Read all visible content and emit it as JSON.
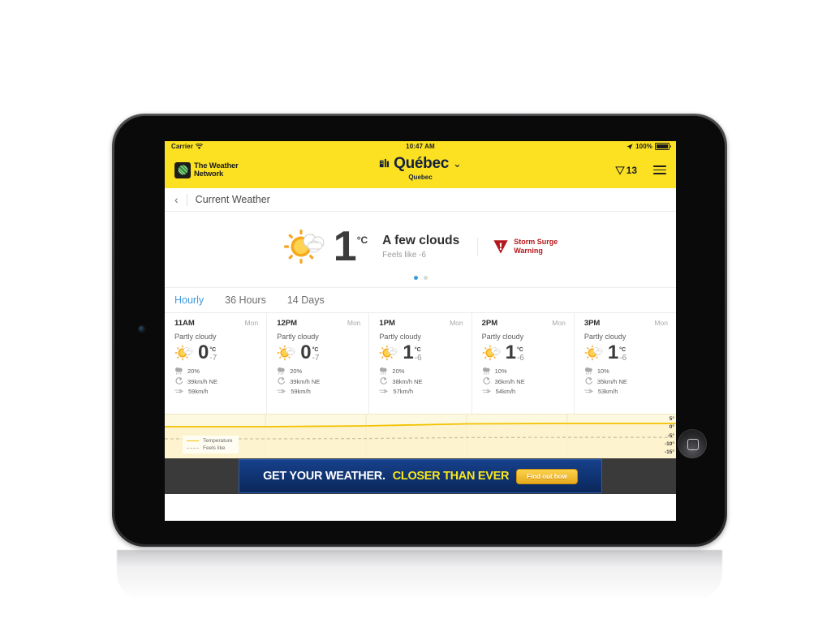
{
  "status_bar": {
    "carrier": "Carrier",
    "wifi_icon": "wifi-icon",
    "time": "10:47 AM",
    "location_icon": "location-arrow-icon",
    "battery_percent": "100%"
  },
  "header": {
    "logo_line1": "The Weather",
    "logo_line2": "Network",
    "logo_icon": "weather-network-globe-icon",
    "city_icon": "city-buildings-icon",
    "city": "Québec",
    "chevron": "⌄",
    "region": "Quebec",
    "alert_icon": "alert-triangle-icon",
    "alert_count": "13",
    "menu_icon": "hamburger-menu-icon"
  },
  "nav": {
    "back_icon": "chevron-left-icon",
    "title": "Current Weather"
  },
  "current": {
    "weather_icon": "sun-behind-cloud-icon",
    "temperature": "1",
    "unit": "°C",
    "condition": "A few clouds",
    "feels_like": "Feels like -6",
    "warning_icon": "storm-warning-triangle-icon",
    "warning_line1": "Storm Surge",
    "warning_line2": "Warning",
    "pagination": {
      "total": 2,
      "active": 0
    }
  },
  "tabs": [
    {
      "label": "Hourly",
      "active": true
    },
    {
      "label": "36 Hours",
      "active": false
    },
    {
      "label": "14 Days",
      "active": false
    }
  ],
  "hourly": [
    {
      "time": "11AM",
      "day": "Mon",
      "condition": "Partly cloudy",
      "icon": "sun-behind-cloud-icon",
      "temp": "0",
      "unit": "°C",
      "feels_like": "-7",
      "precip_icon": "rain-cloud-icon",
      "precip": "20%",
      "wind_icon": "wind-direction-icon",
      "wind": "39km/h NE",
      "gust_icon": "wind-gust-icon",
      "gust": "59km/h"
    },
    {
      "time": "12PM",
      "day": "Mon",
      "condition": "Partly cloudy",
      "icon": "sun-behind-cloud-icon",
      "temp": "0",
      "unit": "°C",
      "feels_like": "-7",
      "precip_icon": "rain-cloud-icon",
      "precip": "20%",
      "wind_icon": "wind-direction-icon",
      "wind": "39km/h NE",
      "gust_icon": "wind-gust-icon",
      "gust": "59km/h"
    },
    {
      "time": "1PM",
      "day": "Mon",
      "condition": "Partly cloudy",
      "icon": "sun-behind-cloud-icon",
      "temp": "1",
      "unit": "°C",
      "feels_like": "-6",
      "precip_icon": "rain-cloud-icon",
      "precip": "20%",
      "wind_icon": "wind-direction-icon",
      "wind": "38km/h NE",
      "gust_icon": "wind-gust-icon",
      "gust": "57km/h"
    },
    {
      "time": "2PM",
      "day": "Mon",
      "condition": "Partly cloudy",
      "icon": "sun-behind-cloud-icon",
      "temp": "1",
      "unit": "°C",
      "feels_like": "-6",
      "precip_icon": "rain-cloud-icon",
      "precip": "10%",
      "wind_icon": "wind-direction-icon",
      "wind": "36km/h NE",
      "gust_icon": "wind-gust-icon",
      "gust": "54km/h"
    },
    {
      "time": "3PM",
      "day": "Mon",
      "condition": "Partly cloudy",
      "icon": "sun-behind-cloud-icon",
      "temp": "1",
      "unit": "°C",
      "feels_like": "-6",
      "precip_icon": "rain-cloud-icon",
      "precip": "10%",
      "wind_icon": "wind-direction-icon",
      "wind": "35km/h NE",
      "gust_icon": "wind-gust-icon",
      "gust": "53km/h"
    }
  ],
  "chart_data": {
    "type": "line",
    "title": "",
    "xlabel": "",
    "ylabel": "",
    "categories": [
      "11AM",
      "12PM",
      "1PM",
      "2PM",
      "3PM"
    ],
    "series": [
      {
        "name": "Temperature",
        "values": [
          0,
          0,
          1,
          1,
          1
        ],
        "color": "#F2C200",
        "style": "solid"
      },
      {
        "name": "Feels like",
        "values": [
          -7,
          -7,
          -6,
          -6,
          -6
        ],
        "color": "#c9c3a0",
        "style": "dashed"
      }
    ],
    "ylim": [
      -15,
      5
    ],
    "yticks": [
      "5°",
      "0°",
      "-5°",
      "-10°",
      "-15°"
    ],
    "grid": true,
    "legend": {
      "position": "bottom-left",
      "entries": [
        "Temperature",
        "Feels like"
      ]
    }
  },
  "ad": {
    "text_white": "GET YOUR WEATHER.",
    "text_yellow": "CLOSER THAN EVER",
    "button_label": "Find out how"
  },
  "colors": {
    "brand_yellow": "#FBE122",
    "accent_blue": "#3b9ae1",
    "warning_red": "#b5171c",
    "chart_line": "#F2C200",
    "ad_blue": "#103473"
  }
}
